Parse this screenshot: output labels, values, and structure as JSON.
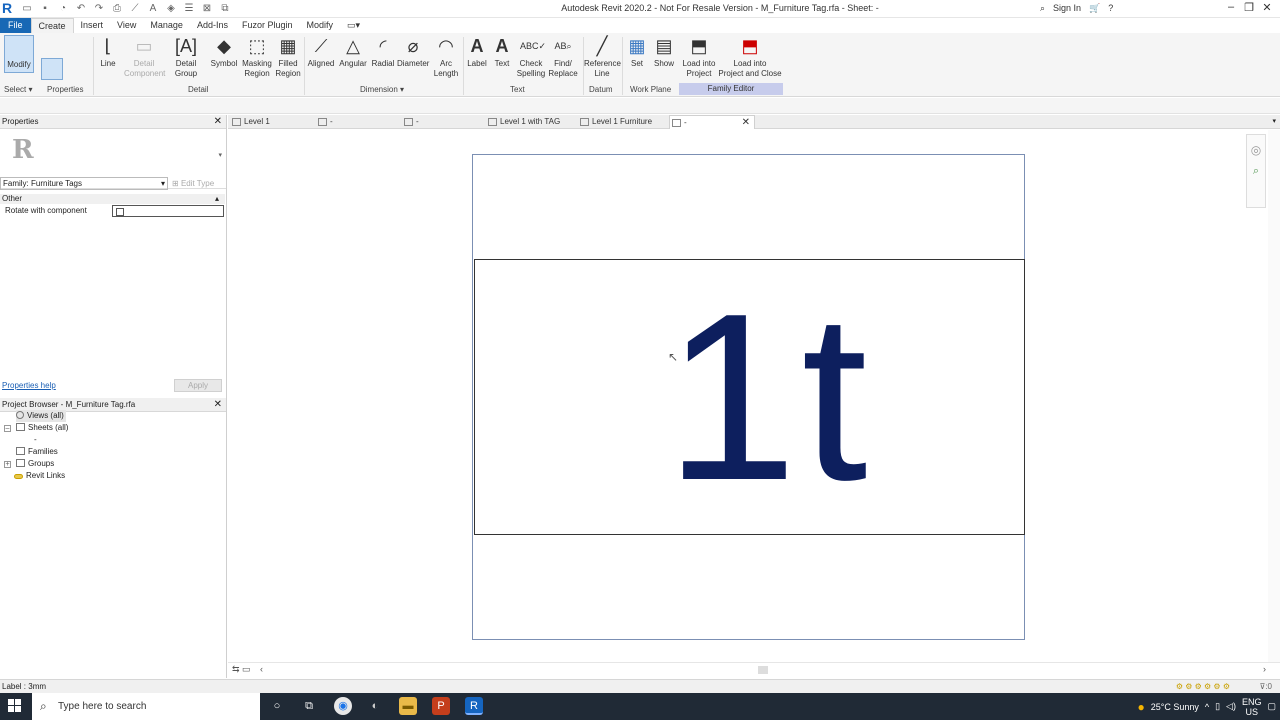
{
  "title": {
    "window_title": "Autodesk Revit 2020.2 - Not For Resale Version - M_Furniture Tag.rfa - Sheet: -",
    "sign_in": "Sign In",
    "app_logo": "R"
  },
  "menu": [
    "File",
    "Create",
    "Insert",
    "View",
    "Manage",
    "Add-Ins",
    "Fuzor Plugin",
    "Modify"
  ],
  "ribbon": {
    "modify_label": "Modify",
    "select_label": "Select ▾",
    "properties_label": "Properties",
    "tools": [
      {
        "label": "Line",
        "icon": "line-icon"
      },
      {
        "label": "Detail\nComponent",
        "icon": "detail-component-icon",
        "disabled": true
      },
      {
        "label": "Detail\nGroup",
        "icon": "detail-group-icon"
      },
      {
        "label": "Symbol",
        "icon": "symbol-icon"
      },
      {
        "label": "Masking\nRegion",
        "icon": "masking-region-icon"
      },
      {
        "label": "Filled\nRegion",
        "icon": "filled-region-icon"
      },
      {
        "label": "Aligned",
        "icon": "aligned-dimension-icon"
      },
      {
        "label": "Angular",
        "icon": "angular-dimension-icon"
      },
      {
        "label": "Radial",
        "icon": "radial-dimension-icon"
      },
      {
        "label": "Diameter",
        "icon": "diameter-dimension-icon"
      },
      {
        "label": "Arc\nLength",
        "icon": "arc-length-icon"
      },
      {
        "label": "Label",
        "icon": "label-icon"
      },
      {
        "label": "Text",
        "icon": "text-icon"
      },
      {
        "label": "Check\nSpelling",
        "icon": "spelling-icon"
      },
      {
        "label": "Find/\nReplace",
        "icon": "find-replace-icon"
      },
      {
        "label": "Reference\nLine",
        "icon": "reference-line-icon"
      },
      {
        "label": "Set",
        "icon": "set-workplane-icon"
      },
      {
        "label": "Show",
        "icon": "show-workplane-icon"
      },
      {
        "label": "Load into\nProject",
        "icon": "load-into-project-icon"
      },
      {
        "label": "Load into\nProject and Close",
        "icon": "load-close-icon"
      }
    ],
    "panels": {
      "detail": "Detail",
      "dimension": "Dimension ▾",
      "text": "Text",
      "datum": "Datum",
      "work_plane": "Work Plane",
      "family_editor": "Family Editor"
    }
  },
  "properties": {
    "title": "Properties",
    "family": "Family: Furniture Tags",
    "edit_type": "Edit Type",
    "group": "Other",
    "param_name": "Rotate with component",
    "param_checked": false,
    "help": "Properties help",
    "apply": "Apply"
  },
  "browser": {
    "title": "Project Browser - M_Furniture Tag.rfa",
    "items": [
      "Views (all)",
      "Sheets (all)",
      "-",
      "Families",
      "Groups",
      "Revit Links"
    ]
  },
  "tabs": [
    "Level 1",
    "-",
    "-",
    "Level 1 with TAG",
    "Level 1 Furniture",
    "-"
  ],
  "canvas": {
    "tag_text": "1t"
  },
  "status": {
    "text": "Label : 3mm"
  },
  "taskbar": {
    "search_placeholder": "Type here to search",
    "weather": "25°C  Sunny",
    "lang": "ENG",
    "region": "US"
  }
}
